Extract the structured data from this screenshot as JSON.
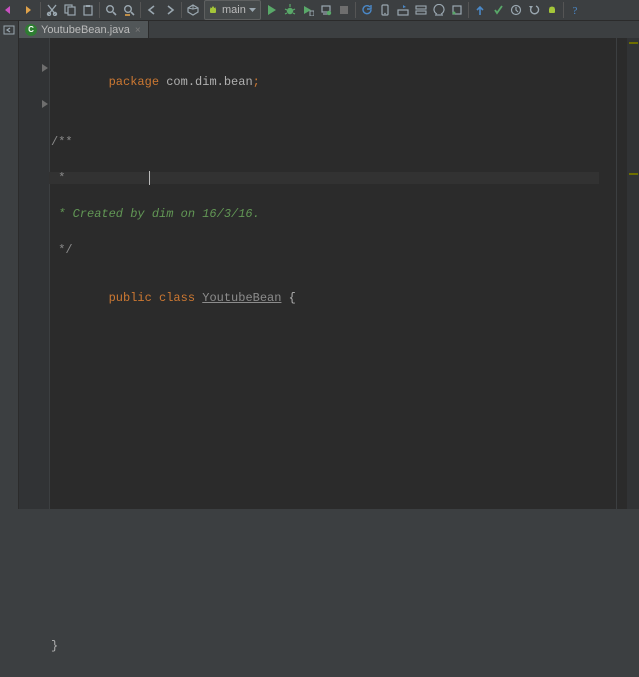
{
  "toolbar": {
    "run_config": "main"
  },
  "tab": {
    "title": "YoutubeBean.java",
    "file_badge": "C"
  },
  "code": {
    "l1_kw": "package",
    "l1_pkg": "com.dim.bean",
    "l1_semi": ";",
    "l3_doc_open": "/**",
    "l4_doc_star": " *",
    "l5_doc": " * Created by dim on 16/3/16.",
    "l6_doc_close": " */",
    "l7_public": "public",
    "l7_class": "class",
    "l7_name": "YoutubeBean",
    "l7_brace": "{",
    "l17_brace": "}"
  }
}
